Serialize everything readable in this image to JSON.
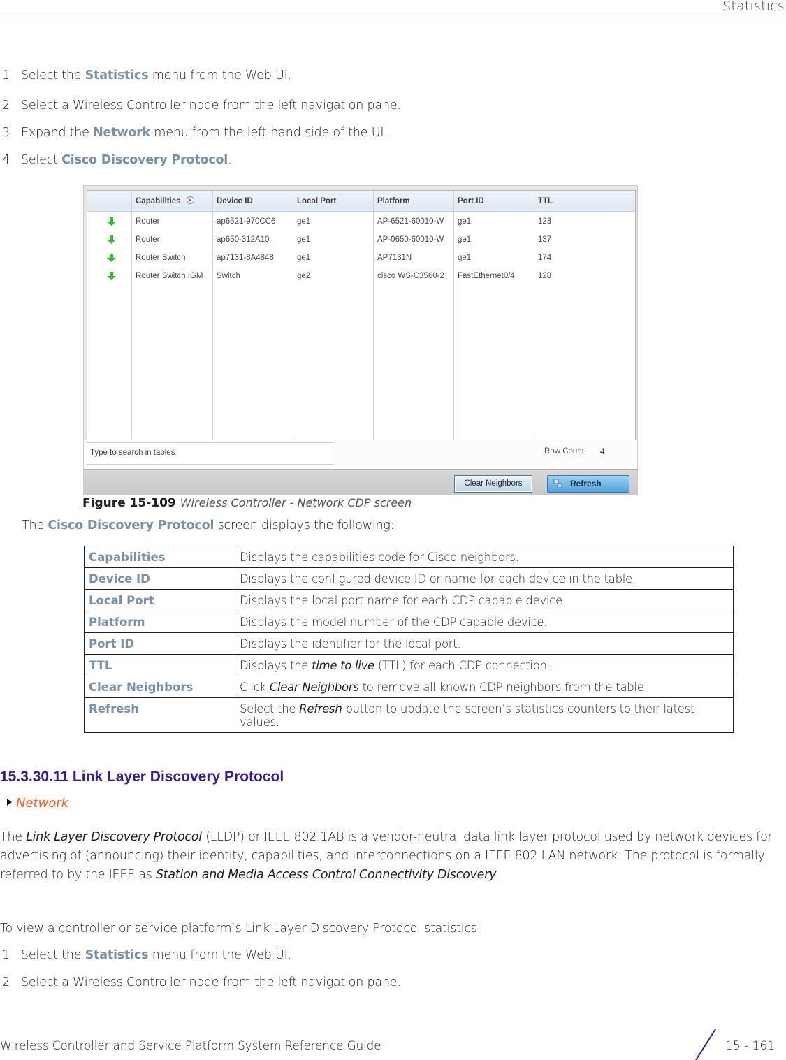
{
  "header": {
    "section_title": "Statistics"
  },
  "steps_top": [
    {
      "num": "1",
      "pre": "Select the ",
      "highlight": "Statistics",
      "post": " menu from the Web UI."
    },
    {
      "num": "2",
      "pre": "Select a Wireless Controller node from the left navigation pane.",
      "highlight": "",
      "post": ""
    },
    {
      "num": "3",
      "pre": "Expand the ",
      "highlight": "Network",
      "post": " menu from the left-hand side of the UI."
    },
    {
      "num": "4",
      "pre": "Select ",
      "highlight": "Cisco Discovery Protocol",
      "post": "."
    }
  ],
  "screenshot": {
    "columns": [
      "",
      "Capabilities",
      "Device ID",
      "Local Port",
      "Platform",
      "Port ID",
      "TTL"
    ],
    "rows": [
      {
        "status": "up-arrow-icon",
        "capabilities": "Router",
        "device_id": "ap6521-970CC6",
        "local_port": "ge1",
        "platform": "AP-6521-60010-W",
        "port_id": "ge1",
        "ttl": "123"
      },
      {
        "status": "up-arrow-icon",
        "capabilities": "Router",
        "device_id": "ap650-312A10",
        "local_port": "ge1",
        "platform": "AP-0650-60010-W",
        "port_id": "ge1",
        "ttl": "137"
      },
      {
        "status": "up-arrow-icon",
        "capabilities": "Router Switch",
        "device_id": "ap7131-8A4848",
        "local_port": "ge1",
        "platform": "AP7131N",
        "port_id": "ge1",
        "ttl": "174"
      },
      {
        "status": "up-arrow-icon",
        "capabilities": "Router Switch IGM",
        "device_id": "Switch",
        "local_port": "ge2",
        "platform": "cisco WS-C3560-2",
        "port_id": "FastEthernet0/4",
        "ttl": "128"
      }
    ],
    "search_placeholder": "Type to search in tables",
    "row_count_label": "Row Count:",
    "row_count_value": "4",
    "clear_button": "Clear Neighbors",
    "refresh_button": "Refresh"
  },
  "figure": {
    "number": "Figure 15-109",
    "caption": "Wireless Controller - Network CDP screen"
  },
  "intro": {
    "pre": "The ",
    "highlight": "Cisco Discovery Protocol",
    "post": " screen displays the following:"
  },
  "desc_table": [
    {
      "term": "Capabilities",
      "pre": "Displays the capabilities code for Cisco neighbors.",
      "em": "",
      "post": ""
    },
    {
      "term": "Device ID",
      "pre": "Displays the configured device ID or name for each device in the table.",
      "em": "",
      "post": ""
    },
    {
      "term": "Local Port",
      "pre": "Displays the local port name for each CDP capable device.",
      "em": "",
      "post": ""
    },
    {
      "term": "Platform",
      "pre": "Displays the model number of the CDP capable device.",
      "em": "",
      "post": ""
    },
    {
      "term": "Port ID",
      "pre": "Displays the identifier for the local port.",
      "em": "",
      "post": ""
    },
    {
      "term": "TTL",
      "pre": "Displays the ",
      "em": "time to live",
      "post": " (TTL) for each CDP connection."
    },
    {
      "term": "Clear Neighbors",
      "pre": "Click ",
      "em": "Clear Neighbors",
      "post": " to remove all known CDP neighbors from the table."
    },
    {
      "term": "Refresh",
      "pre": "Select the ",
      "em": "Refresh",
      "post": " button to update the screen’s statistics counters to their latest values."
    }
  ],
  "section": {
    "heading": "15.3.30.11  Link Layer Discovery Protocol",
    "breadcrumb": "Network",
    "para1": {
      "t1": "The ",
      "e1": "Link Layer Discovery Protocol",
      "t2": " (LLDP) or IEEE 802.1AB is a vendor-neutral data link layer protocol used by network devices for advertising of (announcing) their identity, capabilities, and interconnections on a IEEE 802 LAN network. The protocol is formally referred to by the IEEE as ",
      "e2": "Station and Media Access Control Connectivity Discovery",
      "t3": "."
    },
    "para2": "To view a controller or service platform’s Link Layer Discovery Protocol statistics:",
    "steps": [
      {
        "num": "1",
        "pre": "Select the ",
        "highlight": "Statistics",
        "post": " menu from the Web UI."
      },
      {
        "num": "2",
        "pre": "Select a Wireless Controller node from the left navigation pane.",
        "highlight": "",
        "post": ""
      }
    ]
  },
  "footer": {
    "guide_title": "Wireless Controller and Service Platform System Reference Guide",
    "page": "15 - 161"
  }
}
